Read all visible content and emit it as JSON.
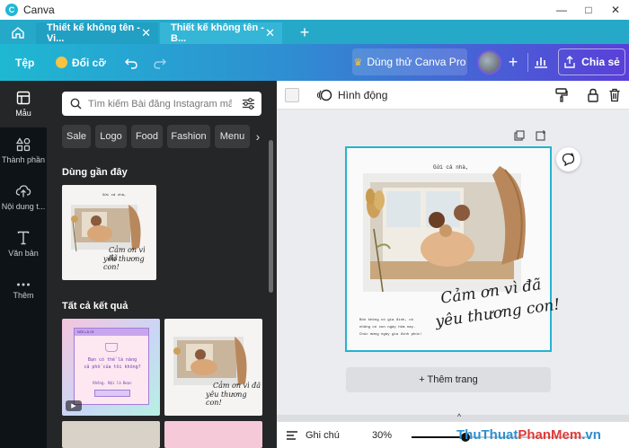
{
  "app": {
    "title": "Canva"
  },
  "tabs": [
    {
      "label": "Thiết kế không tên - Vi..."
    },
    {
      "label": "Thiết kế không tên - B..."
    }
  ],
  "toolbar": {
    "file_label": "Tệp",
    "resize_label": "Đổi cỡ",
    "try_pro_label": "Dùng thử Canva Pro",
    "share_label": "Chia sẻ"
  },
  "rail": {
    "items": [
      {
        "label": "Mẫu",
        "icon": "template-icon"
      },
      {
        "label": "Thành phần",
        "icon": "elements-icon"
      },
      {
        "label": "Nội dung t...",
        "icon": "upload-icon"
      },
      {
        "label": "Văn bản",
        "icon": "text-icon"
      },
      {
        "label": "Thêm",
        "icon": "more-icon"
      }
    ]
  },
  "panel": {
    "search_placeholder": "Tìm kiếm Bài đăng Instagram mẫu",
    "chips": [
      "Sale",
      "Logo",
      "Food",
      "Fashion",
      "Menu"
    ],
    "recent_title": "Dùng gần đây",
    "results_title": "Tất cả kết quả"
  },
  "template": {
    "top_note": "Gửi cả nhà,",
    "script_line1": "Cảm ơn vì đã",
    "script_line2": "yêu thương con!",
    "body_line1": "Bốn không có gia đình, có",
    "body_line2": "những có con ngày hôm nay.",
    "body_line3": "Chúc mừng ngày gia đình phúc!"
  },
  "pink_card": {
    "header": "NỘI LÀ GÌ",
    "line1": "Bạn có thể là nàng",
    "line2": "cả phố của tôi không?",
    "q": "Không. Nội là Được"
  },
  "editor": {
    "animate_label": "Hình động",
    "add_page_label": "+ Thêm trang",
    "notes_label": "Ghi chú",
    "zoom": "30%",
    "zoom_fraction": 0.3
  },
  "watermark": {
    "part1": "ThuThuat",
    "part2": "PhanMem",
    "part3": ".vn"
  },
  "colors": {
    "accent": "#24b3cf",
    "tabbar": "#26a9c9",
    "rail": "#0e1318",
    "panel": "#252627"
  }
}
